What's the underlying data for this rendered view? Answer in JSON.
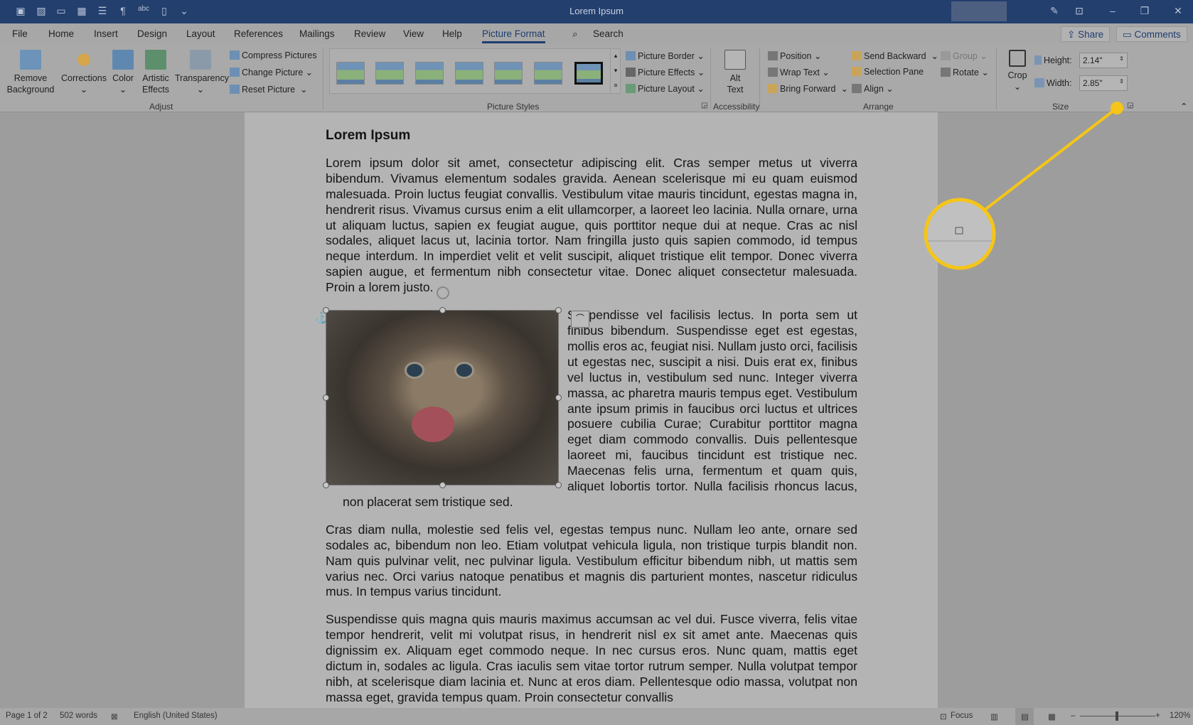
{
  "window": {
    "title": "Lorem Ipsum"
  },
  "tabs": [
    "File",
    "Home",
    "Insert",
    "Design",
    "Layout",
    "References",
    "Mailings",
    "Review",
    "View",
    "Help",
    "Picture Format"
  ],
  "active_tab": "Picture Format",
  "search": "Search",
  "share": "Share",
  "comments": "Comments",
  "ribbon": {
    "adjust": {
      "remove_bg": [
        "Remove",
        "Background"
      ],
      "corrections": "Corrections",
      "color": "Color",
      "artistic": [
        "Artistic",
        "Effects"
      ],
      "transparency": "Transparency",
      "compress": "Compress Pictures",
      "change": "Change Picture",
      "reset": "Reset Picture",
      "label": "Adjust"
    },
    "styles": {
      "border": "Picture Border",
      "effects": "Picture Effects",
      "layout": "Picture Layout",
      "label": "Picture Styles"
    },
    "accessibility": {
      "alt": [
        "Alt",
        "Text"
      ],
      "label": "Accessibility"
    },
    "arrange": {
      "position": "Position",
      "wrap": "Wrap Text",
      "bring": "Bring Forward",
      "send": "Send Backward",
      "selection": "Selection Pane",
      "align": "Align",
      "group": "Group",
      "rotate": "Rotate",
      "label": "Arrange"
    },
    "size": {
      "crop": "Crop",
      "height_label": "Height:",
      "height": "2.14\"",
      "width_label": "Width:",
      "width": "2.85\"",
      "label": "Size"
    }
  },
  "doc": {
    "heading": "Lorem Ipsum",
    "p1": "Lorem ipsum dolor sit amet, consectetur adipiscing elit. Cras semper metus ut viverra bibendum. Vivamus elementum sodales gravida. Aenean scelerisque mi eu quam euismod malesuada. Proin luctus feugiat convallis. Vestibulum vitae mauris tincidunt, egestas magna in, hendrerit risus. Vivamus cursus enim a elit ullamcorper, a laoreet leo lacinia. Nulla ornare, urna ut aliquam luctus, sapien ex feugiat augue, quis porttitor neque dui at neque. Cras ac nisl sodales, aliquet lacus ut, lacinia tortor. Nam fringilla justo quis sapien commodo, id tempus neque interdum. In imperdiet velit et velit suscipit, aliquet tristique elit tempor. Donec viverra sapien augue, et fermentum nibh consectetur vitae. Donec aliquet consectetur malesuada. Proin a lorem justo.",
    "p2": "Suspendisse vel facilisis lectus. In porta sem ut finibus bibendum. Suspendisse eget est egestas, mollis eros ac, feugiat nisi. Nullam justo orci, facilisis ut egestas nec, suscipit a nisi. Duis erat ex, finibus vel luctus in, vestibulum sed nunc. Integer viverra massa, ac pharetra mauris tempus eget. Vestibulum ante ipsum primis in faucibus orci luctus et ultrices posuere cubilia Curae; Curabitur porttitor magna eget diam commodo convallis. Duis pellentesque laoreet mi, faucibus tincidunt est tristique nec. Maecenas felis urna, fermentum et quam quis, aliquet lobortis tortor. Nulla facilisis rhoncus lacus, non placerat sem tristique sed.",
    "p3": "Cras diam nulla, molestie sed felis vel, egestas tempus nunc. Nullam leo ante, ornare sed sodales ac, bibendum non leo. Etiam volutpat vehicula ligula, non tristique turpis blandit non. Nam quis pulvinar velit, nec pulvinar ligula. Vestibulum efficitur bibendum nibh, ut mattis sem varius nec. Orci varius natoque penatibus et magnis dis parturient montes, nascetur ridiculus mus. In tempus varius tincidunt.",
    "p4": "Suspendisse quis magna quis mauris maximus accumsan ac vel dui. Fusce viverra, felis vitae tempor hendrerit, velit mi volutpat risus, in hendrerit nisl ex sit amet ante. Maecenas quis dignissim ex. Aliquam eget commodo neque. In nec cursus eros. Nunc quam, mattis eget dictum in, sodales ac ligula. Cras iaculis sem vitae tortor rutrum semper. Nulla volutpat tempor nibh, at scelerisque diam lacinia et. Nunc at eros diam. Pellentesque odio massa, volutpat non massa eget, gravida tempus quam. Proin consectetur convallis"
  },
  "status": {
    "page": "Page 1 of 2",
    "words": "502 words",
    "language": "English (United States)",
    "focus": "Focus",
    "zoom": "120%"
  },
  "colors": {
    "titlebar": "#233f6e",
    "highlight": "#f5c518"
  }
}
